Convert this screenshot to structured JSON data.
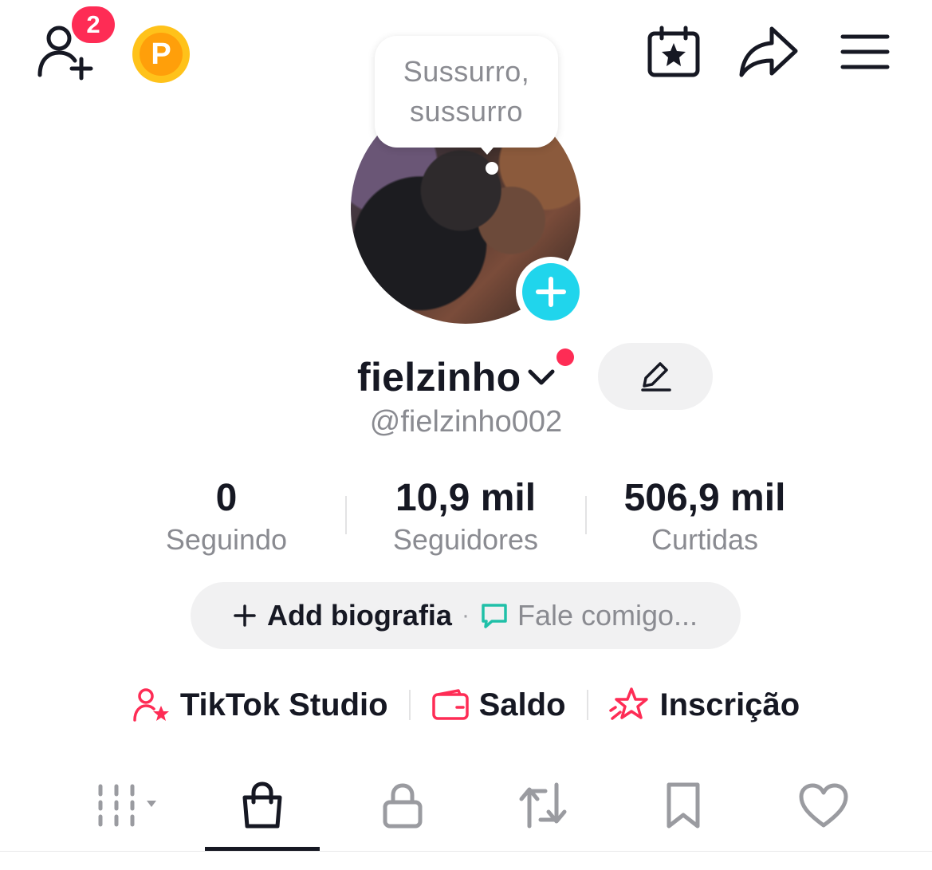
{
  "header": {
    "friend_requests_count": "2",
    "coin_letter": "P"
  },
  "avatar": {
    "bubble_line1": "Sussurro,",
    "bubble_line2": "sussurro"
  },
  "profile": {
    "display_name": "fielzinho",
    "handle": "@fielzinho002"
  },
  "stats": [
    {
      "value": "0",
      "label": "Seguindo"
    },
    {
      "value": "10,9 mil",
      "label": "Seguidores"
    },
    {
      "value": "506,9 mil",
      "label": "Curtidas"
    }
  ],
  "bio": {
    "add_label": "Add biografia",
    "separator": "·",
    "chat_label": "Fale comigo..."
  },
  "links": [
    {
      "label": "TikTok Studio",
      "icon": "person-star-icon"
    },
    {
      "label": "Saldo",
      "icon": "wallet-icon"
    },
    {
      "label": "Inscrição",
      "icon": "star-badge-icon"
    }
  ],
  "tabs": [
    {
      "icon": "grid-icon",
      "selected": false
    },
    {
      "icon": "shopping-bag-icon",
      "selected": true
    },
    {
      "icon": "lock-icon",
      "selected": false
    },
    {
      "icon": "repost-icon",
      "selected": false
    },
    {
      "icon": "bookmark-icon",
      "selected": false
    },
    {
      "icon": "heart-icon",
      "selected": false
    }
  ],
  "colors": {
    "accent_red": "#fe2c55",
    "accent_cyan": "#20d5ec",
    "coin_gold": "#ffc21a",
    "text_primary": "#161823",
    "text_secondary": "#8a8b91",
    "chat_teal": "#20c0a8"
  }
}
